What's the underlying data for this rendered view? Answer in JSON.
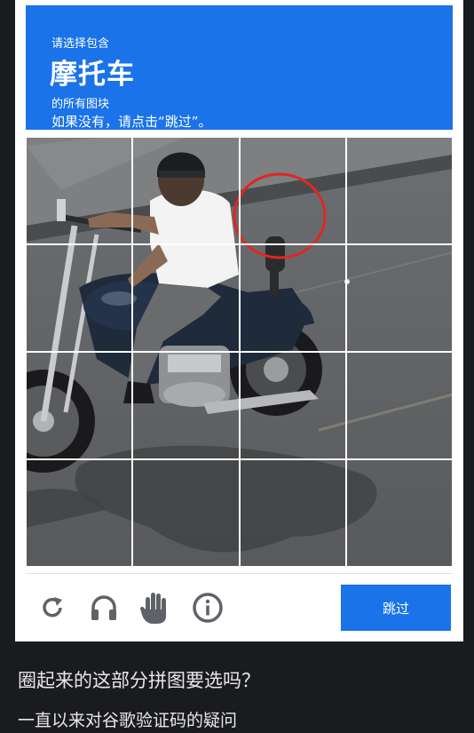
{
  "header": {
    "line1": "请选择包含",
    "object": "摩托车",
    "line3": "的所有图块",
    "line4": "如果没有，请点击“跳过”。"
  },
  "grid": {
    "rows": 4,
    "cols": 4
  },
  "footer": {
    "tools": [
      "reload-icon",
      "headphones-icon",
      "hand-icon",
      "info-icon"
    ],
    "skip_label": "跳过"
  },
  "caption": {
    "line1": "圈起来的这部分拼图要选吗？",
    "line2": "一直以来对谷歌验证码的疑问"
  },
  "colors": {
    "accent": "#1a73e8",
    "circle": "#e0271f",
    "background": "#1a1b1f"
  }
}
